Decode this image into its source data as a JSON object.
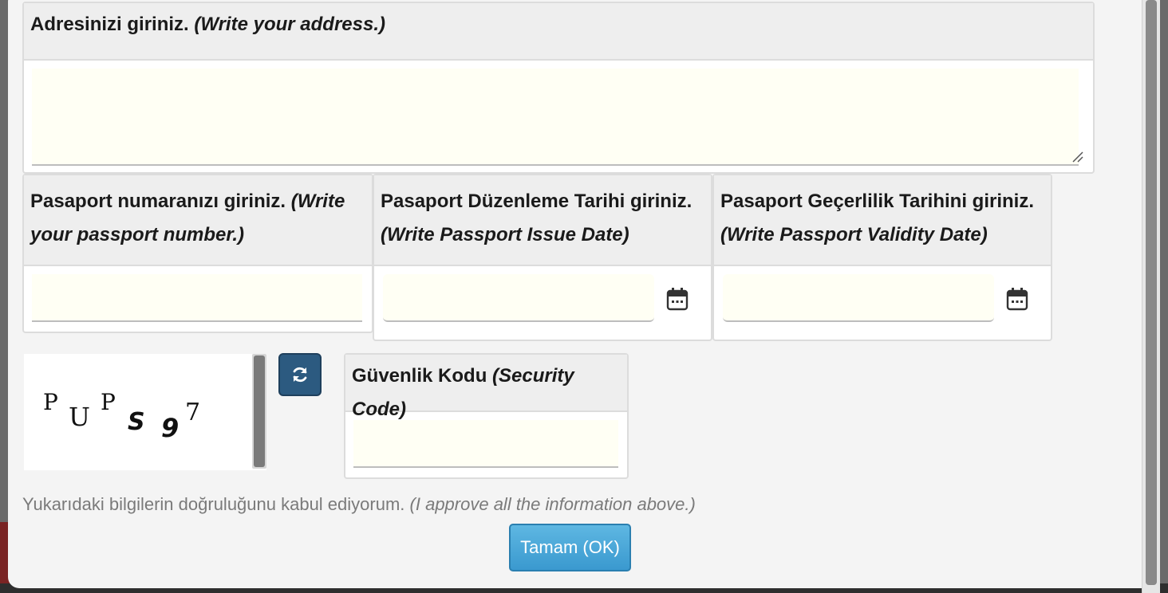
{
  "address": {
    "label_tr": "Adresinizi giriniz.",
    "label_en": "(Write your address.)",
    "value": ""
  },
  "passport_number": {
    "label_tr": "Pasaport numaranızı giriniz.",
    "label_en": "(Write your passport number.)",
    "value": ""
  },
  "issue_date": {
    "label_tr": "Pasaport Düzenleme Tarihi giriniz.",
    "label_en": "(Write Passport Issue Date)",
    "value": ""
  },
  "validity_date": {
    "label_tr": "Pasaport Geçerlilik Tarihini giriniz.",
    "label_en": "(Write Passport Validity Date)",
    "value": ""
  },
  "captcha": {
    "chars": [
      "P",
      "U",
      "P",
      "S",
      "9",
      "7"
    ]
  },
  "security_code": {
    "label_tr": "Güvenlik Kodu",
    "label_en": "(Security Code)",
    "value": ""
  },
  "approve": {
    "text_tr": "Yukarıdaki bilgilerin doğruluğunu kabul ediyorum.",
    "text_en": "(I approve all the information above.)"
  },
  "ok_button": {
    "label": "Tamam (OK)"
  },
  "icons": {
    "calendar": "calendar-icon",
    "refresh": "refresh-icon",
    "resize": "resize-handle-icon"
  },
  "colors": {
    "field_bg": "#fffff4",
    "ok_button": "#3a99cf",
    "refresh_button": "#2c5a80"
  }
}
